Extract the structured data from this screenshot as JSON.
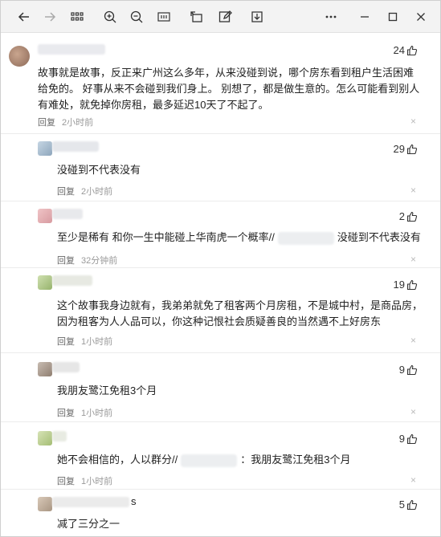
{
  "toolbar": {
    "icons": [
      "back-arrow-icon",
      "forward-arrow-icon",
      "grid-icon",
      "zoom-in-icon",
      "zoom-out-icon",
      "fit-icon",
      "rotate-icon",
      "edit-icon",
      "download-icon",
      "more-icon",
      "minimize-icon",
      "maximize-icon",
      "close-icon"
    ]
  },
  "comments": [
    {
      "likes": "24",
      "text": "故事就是故事，反正来广州这么多年，从来没碰到说，哪个房东看到租户生活困难给免的。 好事从来不会碰到我们身上。 别想了，都是做生意的。怎么可能看到别人有难处，就免掉你房租，最多延迟10天了不起了。",
      "reply": "回复",
      "time": "2小时前",
      "close": "×"
    },
    {
      "likes": "29",
      "text": "没碰到不代表没有",
      "reply": "回复",
      "time": "2小时前",
      "close": "×"
    },
    {
      "likes": "2",
      "text_a": "至少是稀有 和你一生中能碰上华南虎一个概率//",
      "text_b": "没碰到不代表没有",
      "reply": "回复",
      "time": "32分钟前",
      "close": "×"
    },
    {
      "likes": "19",
      "text": "这个故事我身边就有，我弟弟就免了租客两个月房租，不是城中村，是商品房，因为租客为人人品可以，你这种记恨社会质疑善良的当然遇不上好房东",
      "reply": "回复",
      "time": "1小时前",
      "close": "×"
    },
    {
      "likes": "9",
      "text": "我朋友鹭江免租3个月",
      "reply": "回复",
      "time": "1小时前",
      "close": "×"
    },
    {
      "likes": "9",
      "text_a": "她不会相信的，人以群分//",
      "text_b": "：我朋友鹭江免租3个月",
      "reply": "回复",
      "time": "1小时前",
      "close": "×"
    },
    {
      "likes": "5",
      "nick_suffix": "s",
      "text": "减了三分之一"
    }
  ]
}
